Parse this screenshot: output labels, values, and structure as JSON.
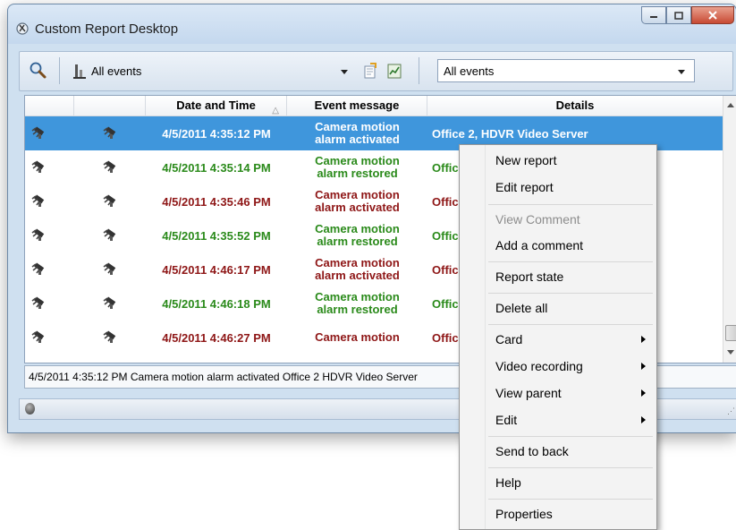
{
  "window": {
    "title": "Custom Report Desktop"
  },
  "toolbar": {
    "events_label": "All events",
    "filter_value": "All events"
  },
  "grid": {
    "columns": {
      "datetime": "Date and Time",
      "message": "Event message",
      "details": "Details"
    },
    "rows": [
      {
        "datetime": "4/5/2011 4:35:12 PM",
        "message_line1": "Camera motion",
        "message_line2": "alarm activated",
        "details": "Office 2, HDVR Video Server",
        "state": "selected"
      },
      {
        "datetime": "4/5/2011 4:35:14 PM",
        "message_line1": "Camera motion",
        "message_line2": "alarm restored",
        "details": "Office",
        "state": "restored"
      },
      {
        "datetime": "4/5/2011 4:35:46 PM",
        "message_line1": "Camera motion",
        "message_line2": "alarm activated",
        "details": "Office,",
        "state": "activated"
      },
      {
        "datetime": "4/5/2011 4:35:52 PM",
        "message_line1": "Camera motion",
        "message_line2": "alarm restored",
        "details": "Office,",
        "state": "restored"
      },
      {
        "datetime": "4/5/2011 4:46:17 PM",
        "message_line1": "Camera motion",
        "message_line2": "alarm activated",
        "details": "Office",
        "state": "activated"
      },
      {
        "datetime": "4/5/2011 4:46:18 PM",
        "message_line1": "Camera motion",
        "message_line2": "alarm restored",
        "details": "Office",
        "state": "restored"
      },
      {
        "datetime": "4/5/2011 4:46:27 PM",
        "message_line1": "Camera motion",
        "message_line2": "",
        "details": "Office",
        "state": "activated"
      }
    ]
  },
  "status_line": "4/5/2011 4:35:12 PM  Camera motion alarm activated  Office 2  HDVR Video Server",
  "context_menu": {
    "items": [
      {
        "label": "New report"
      },
      {
        "label": "Edit report"
      },
      {
        "label": "View Comment",
        "disabled": true
      },
      {
        "label": "Add a comment"
      },
      {
        "label": "Report state"
      },
      {
        "label": "Delete all"
      },
      {
        "label": "Card",
        "submenu": true
      },
      {
        "label": "Video recording",
        "submenu": true
      },
      {
        "label": "View parent",
        "submenu": true
      },
      {
        "label": "Edit",
        "submenu": true
      },
      {
        "label": "Send to back"
      },
      {
        "label": "Help"
      },
      {
        "label": "Properties"
      }
    ]
  },
  "colors": {
    "selected": "#3f96dc",
    "restored": "#2a8a1a",
    "activated": "#8e1616"
  },
  "icons": [
    "app-icon",
    "search-icon",
    "events-icon",
    "export-icon",
    "report-icon",
    "camera-icon",
    "status-led-icon",
    "resize-grip-icon"
  ]
}
